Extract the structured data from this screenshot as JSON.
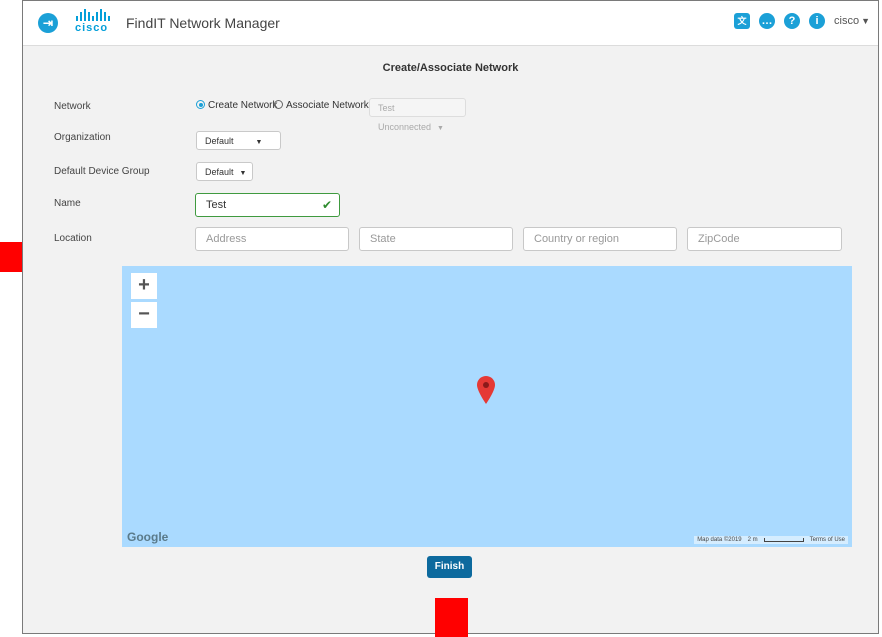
{
  "header": {
    "app_title": "FindIT Network Manager",
    "logo_text": "cisco",
    "user": "cisco",
    "icons": [
      "app-menu-icon",
      "language-icon",
      "chat-icon",
      "help-icon",
      "info-icon"
    ]
  },
  "page_title": "Create/Associate Network",
  "form": {
    "network": {
      "label": "Network",
      "option_create": "Create Network",
      "option_associate": "Associate Network",
      "selected": "Create Network",
      "associate_dropdown": "Test Unconnected"
    },
    "organization": {
      "label": "Organization",
      "value": "Default"
    },
    "device_group": {
      "label": "Default Device Group",
      "value": "Default"
    },
    "name": {
      "label": "Name",
      "value": "Test"
    },
    "location": {
      "label": "Location",
      "address_placeholder": "Address",
      "state_placeholder": "State",
      "country_placeholder": "Country or region",
      "zip_placeholder": "ZipCode"
    }
  },
  "map": {
    "zoom_in": "+",
    "zoom_out": "−",
    "provider": "Google",
    "attribution": "Map data ©2019",
    "scale_label": "2 m",
    "terms": "Terms of Use",
    "water_color": "#aadaff"
  },
  "actions": {
    "finish": "Finish"
  },
  "annotations": {
    "arrow_color": "#ff0000"
  }
}
